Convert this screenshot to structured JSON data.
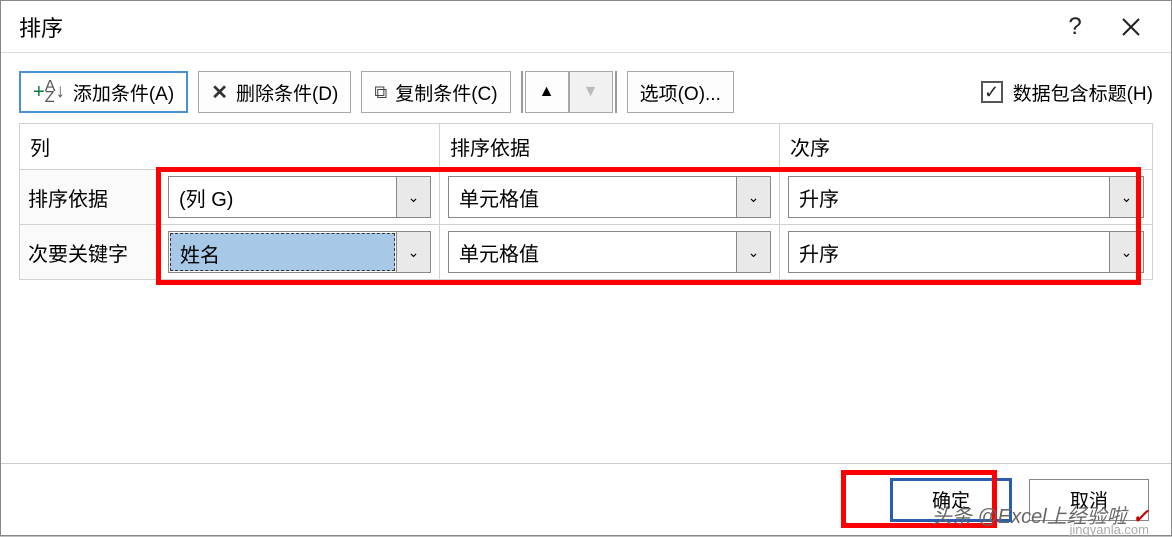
{
  "title": "排序",
  "help_symbol": "?",
  "toolbar": {
    "add_label": "添加条件(A)",
    "del_label": "删除条件(D)",
    "copy_label": "复制条件(C)",
    "options_label": "选项(O)...",
    "checkbox_label": "数据包含标题(H)",
    "checkbox_checked": "✓",
    "up_triangle": "▲",
    "down_triangle": "▼"
  },
  "headers": {
    "col": "列",
    "basis": "排序依据",
    "order": "次序"
  },
  "rows": [
    {
      "label": "排序依据",
      "col_value": "(列 G)",
      "basis_value": "单元格值",
      "order_value": "升序",
      "highlight": false
    },
    {
      "label": "次要关键字",
      "col_value": "姓名",
      "basis_value": "单元格值",
      "order_value": "升序",
      "highlight": true
    }
  ],
  "footer": {
    "ok_label": "确定",
    "cancel_label": "取消"
  },
  "watermark_main": "头条 @Excel上经验啦",
  "watermark_sub": "jingyanla.com",
  "dropdown_glyph": "⌄"
}
